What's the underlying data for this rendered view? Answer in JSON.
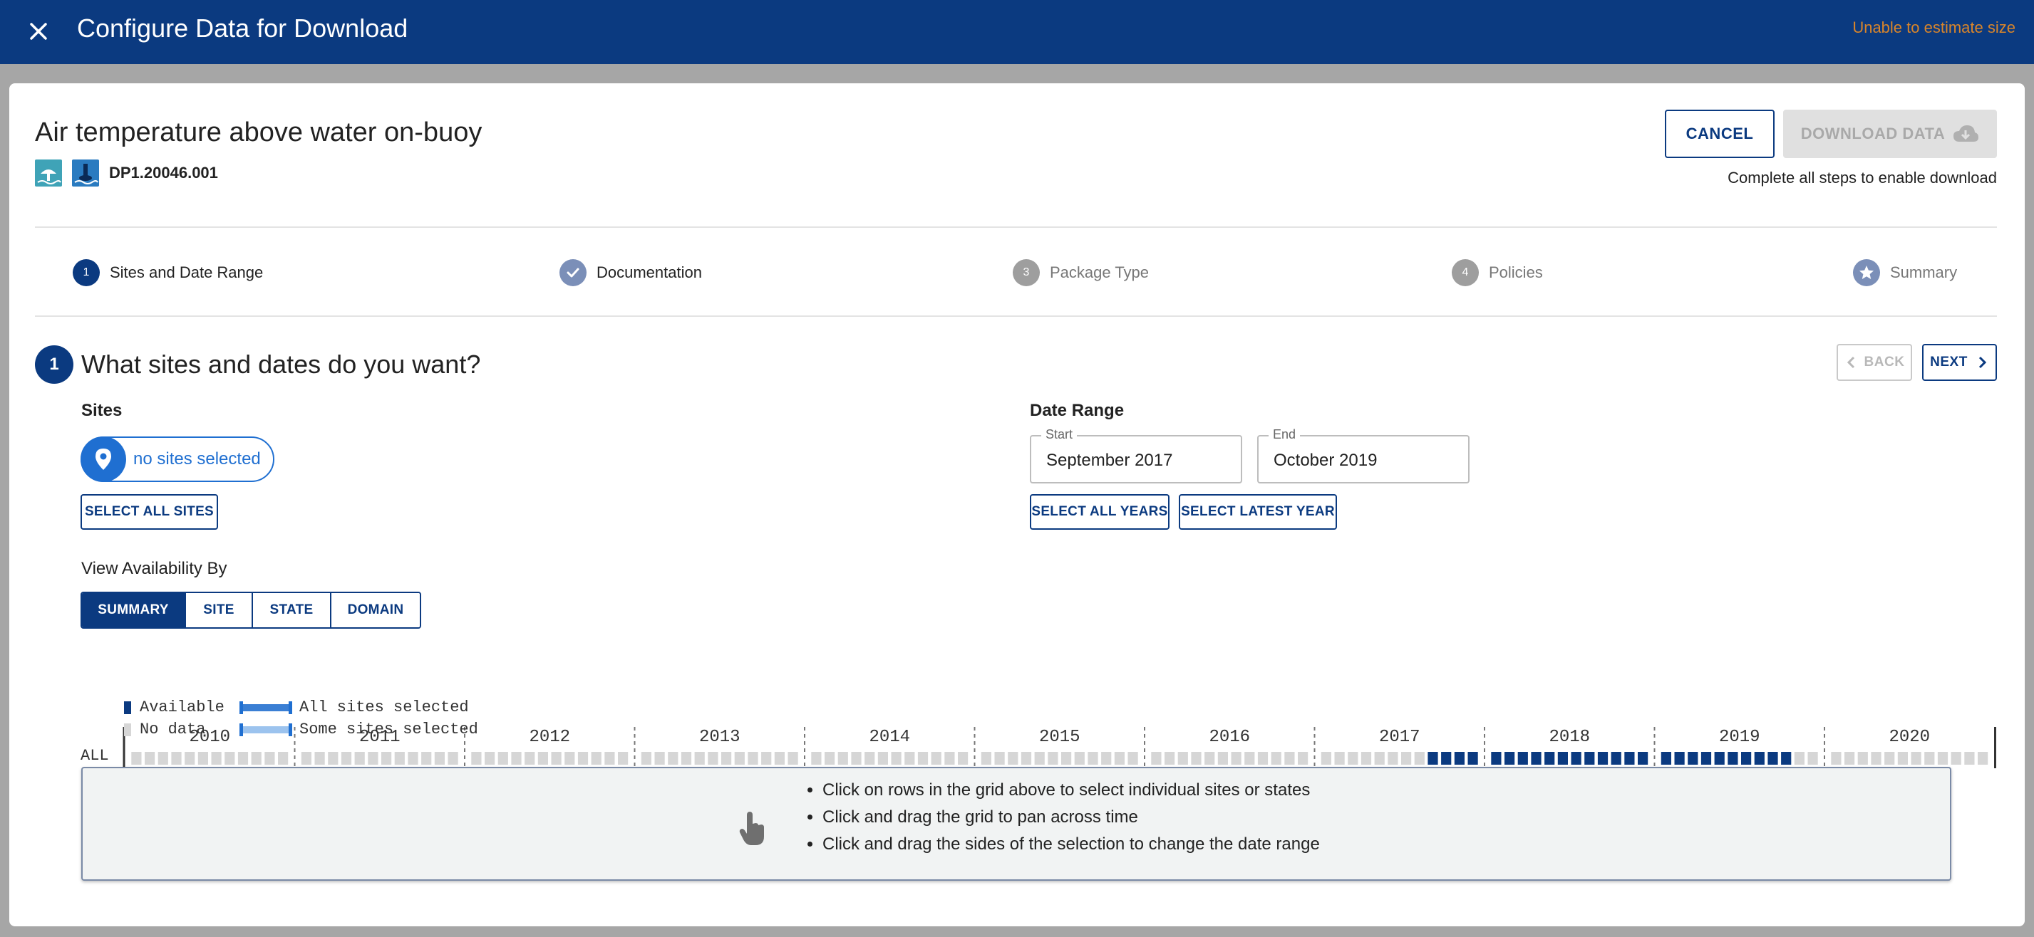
{
  "header": {
    "title": "Configure Data for Download",
    "estimate": "Unable to estimate size",
    "close_icon": "close-icon"
  },
  "product": {
    "title": "Air temperature above water on-buoy",
    "id": "DP1.20046.001",
    "icons": [
      "aquatic-site-icon",
      "buoy-icon"
    ]
  },
  "actions": {
    "cancel": "CANCEL",
    "download": "DOWNLOAD DATA",
    "download_icon": "cloud-download-icon",
    "enable_note": "Complete all steps to enable download"
  },
  "steps": [
    {
      "number": "1",
      "label": "Sites and Date Range",
      "state": "active"
    },
    {
      "number": "",
      "label": "Documentation",
      "state": "complete",
      "icon": "check-icon"
    },
    {
      "number": "3",
      "label": "Package Type",
      "state": "pending"
    },
    {
      "number": "4",
      "label": "Policies",
      "state": "pending"
    },
    {
      "number": "",
      "label": "Summary",
      "state": "pending",
      "icon": "star-icon"
    }
  ],
  "section": {
    "number": "1",
    "title": "What sites and dates do you want?",
    "back": "BACK",
    "next": "NEXT"
  },
  "sites": {
    "label": "Sites",
    "pill_text": "no sites selected",
    "select_all": "SELECT ALL SITES"
  },
  "date_range": {
    "label": "Date Range",
    "start_label": "Start",
    "start_value": "September 2017",
    "end_label": "End",
    "end_value": "October 2019",
    "select_all_years": "SELECT ALL YEARS",
    "select_latest_year": "SELECT LATEST YEAR"
  },
  "view_by": {
    "label": "View Availability By",
    "options": [
      "SUMMARY",
      "SITE",
      "STATE",
      "DOMAIN"
    ],
    "selected": "SUMMARY"
  },
  "availability": {
    "row_label": "ALL",
    "years": [
      "2010",
      "2011",
      "2012",
      "2013",
      "2014",
      "2015",
      "2016",
      "2017",
      "2018",
      "2019",
      "2020"
    ],
    "available_months": [
      "2017-09",
      "2017-10",
      "2017-11",
      "2017-12",
      "2018-01",
      "2018-02",
      "2018-03",
      "2018-04",
      "2018-05",
      "2018-06",
      "2018-07",
      "2018-08",
      "2018-09",
      "2018-10",
      "2018-11",
      "2018-12",
      "2019-01",
      "2019-02",
      "2019-03",
      "2019-04",
      "2019-05",
      "2019-06",
      "2019-07",
      "2019-08",
      "2019-09",
      "2019-10"
    ],
    "colors": {
      "available": "#0b3a80",
      "no_data": "#d6d6d6",
      "all_selected": "#3a7fd4",
      "some_selected": "#9cc3ee"
    }
  },
  "legend": {
    "available": "Available",
    "no_data": "No data",
    "all_selected": "All sites selected",
    "some_selected": "Some sites selected"
  },
  "tips": {
    "icon": "touch-hand-icon",
    "items": [
      "Click on rows in the grid above to select individual sites or states",
      "Click and drag the grid to pan across time",
      "Click and drag the sides of the selection to change the date range"
    ]
  }
}
